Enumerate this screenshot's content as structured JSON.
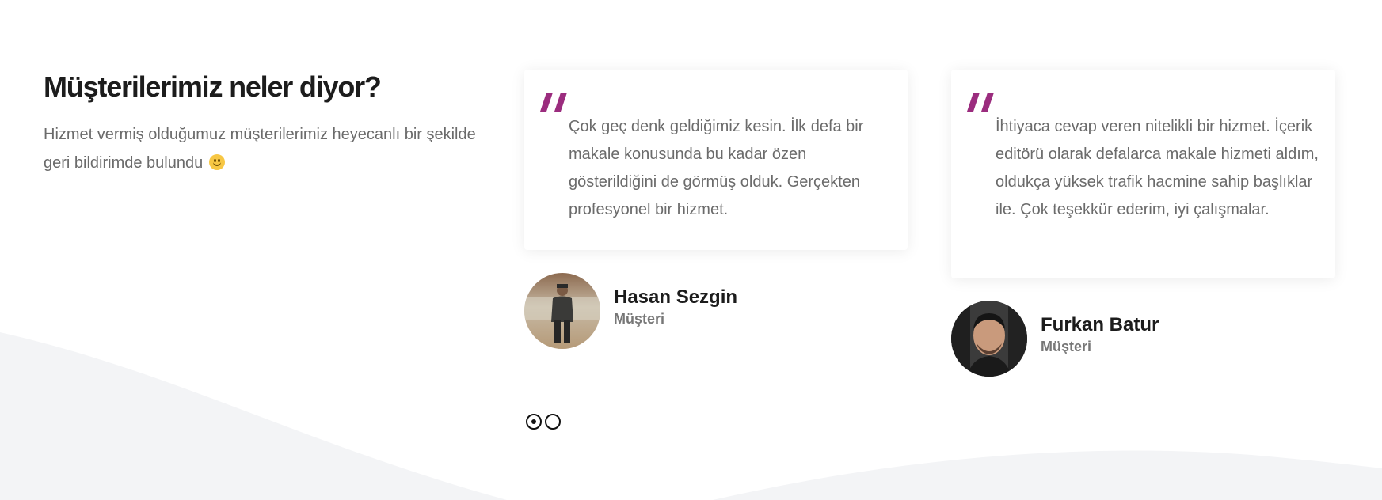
{
  "section": {
    "title": "Müşterilerimiz neler diyor?",
    "description": "Hizmet vermiş olduğumuz müşterilerimiz heyecanlı bir şekilde geri bildirimde bulundu",
    "emoji": "slightly-smiling-face"
  },
  "testimonials": [
    {
      "quote_icon": "quote-mark-icon",
      "text": "Çok geç denk geldiğimiz kesin. İlk defa bir makale konusunda bu kadar özen gösterildiğini de görmüş olduk. Gerçekten profesyonel bir hizmet.",
      "name": "Hasan Sezgin",
      "role": "Müşteri"
    },
    {
      "quote_icon": "quote-mark-icon",
      "text": "İhtiyaca cevap veren nitelikli bir hizmet. İçerik editörü olarak defalarca makale hizmeti aldım, oldukça yüksek trafik hacmine sahip başlıklar ile. Çok teşekkür ederim, iyi çalışmalar.",
      "name": "Furkan Batur",
      "role": "Müşteri"
    }
  ],
  "carousel": {
    "pages": 2,
    "active_index": 0
  },
  "colors": {
    "accent": "#9b2c7e",
    "heading": "#1c1c1c",
    "body_text": "#6b6b6b",
    "wave": "#f3f4f6"
  }
}
